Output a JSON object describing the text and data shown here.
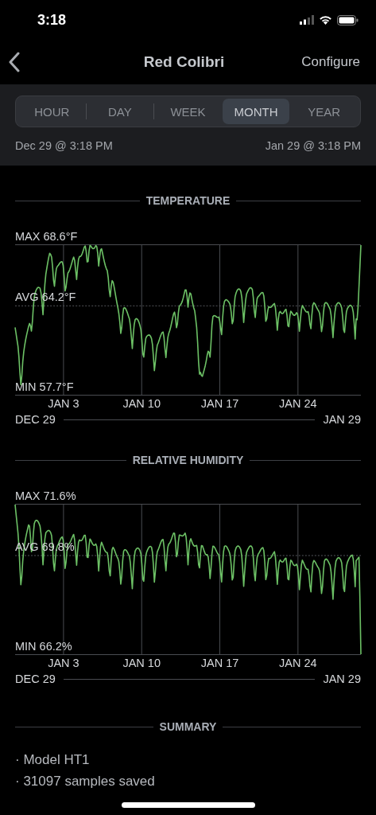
{
  "status_bar": {
    "time": "3:18"
  },
  "nav": {
    "title": "Red Colibri",
    "action": "Configure"
  },
  "tabs": [
    {
      "label": "HOUR",
      "selected": false
    },
    {
      "label": "DAY",
      "selected": false
    },
    {
      "label": "WEEK",
      "selected": false
    },
    {
      "label": "MONTH",
      "selected": true
    },
    {
      "label": "YEAR",
      "selected": false
    }
  ],
  "range": {
    "start": "Dec 29 @ 3:18 PM",
    "end": "Jan 29 @ 3:18 PM"
  },
  "charts": [
    {
      "title": "TEMPERATURE",
      "max": "MAX 68.6°F",
      "avg": "AVG 64.2°F",
      "min": "MIN 57.7°F",
      "ticks": [
        "JAN 3",
        "JAN 10",
        "JAN 17",
        "JAN 24"
      ],
      "start": "DEC 29",
      "end": "JAN 29"
    },
    {
      "title": "RELATIVE HUMIDITY",
      "max": "MAX 71.6%",
      "avg": "AVG 69.8%",
      "min": "MIN 66.2%",
      "ticks": [
        "JAN 3",
        "JAN 10",
        "JAN 17",
        "JAN 24"
      ],
      "start": "DEC 29",
      "end": "JAN 29"
    }
  ],
  "summary": {
    "title": "SUMMARY",
    "items": [
      "· Model HT1",
      "· 31097 samples saved"
    ]
  }
}
